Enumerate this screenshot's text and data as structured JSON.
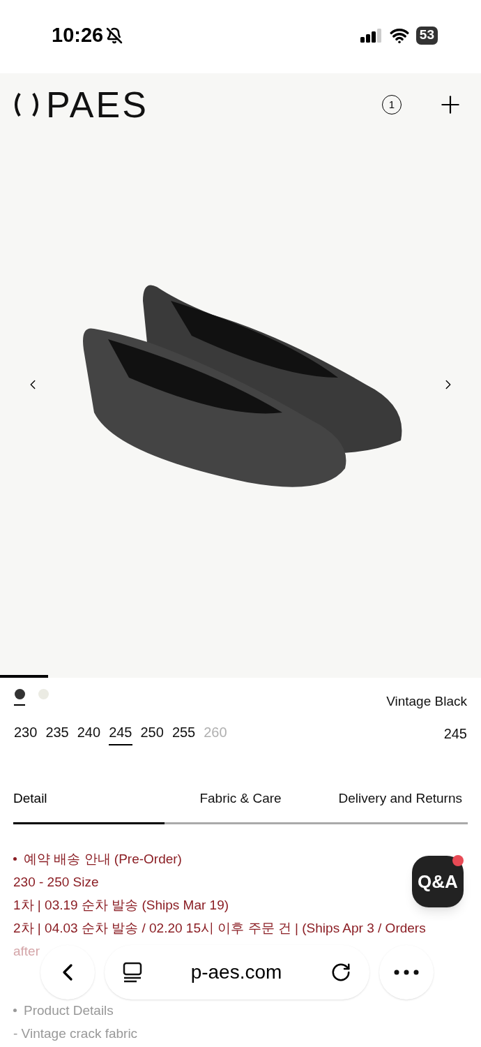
{
  "status_bar": {
    "time": "10:26",
    "battery": "53",
    "muted": true
  },
  "header": {
    "logo": "PAES",
    "cart_count": "1"
  },
  "gallery": {
    "level": 0.1
  },
  "colors": {
    "name": "Vintage Black",
    "swatches": [
      {
        "color": "#333333",
        "selected": true
      },
      {
        "color": "#ebebe3",
        "selected": false
      }
    ]
  },
  "sizes": {
    "selected_label": "245",
    "items": [
      {
        "label": "230",
        "selected": false,
        "disabled": false
      },
      {
        "label": "235",
        "selected": false,
        "disabled": false
      },
      {
        "label": "240",
        "selected": false,
        "disabled": false
      },
      {
        "label": "245",
        "selected": true,
        "disabled": false
      },
      {
        "label": "250",
        "selected": false,
        "disabled": false
      },
      {
        "label": "255",
        "selected": false,
        "disabled": false
      },
      {
        "label": "260",
        "selected": false,
        "disabled": true
      }
    ]
  },
  "tabs": [
    {
      "label": "Detail",
      "selected": true
    },
    {
      "label": "Fabric & Care",
      "selected": false
    },
    {
      "label": "Delivery and Returns",
      "selected": false
    }
  ],
  "detail_lines": [
    {
      "kind": "bullet",
      "text": "예약 배송 안내 (Pre-Order)"
    },
    {
      "kind": "line",
      "text": "230 - 250 Size"
    },
    {
      "kind": "line",
      "text": "1차 | 03.19 순차 발송 (Ships Mar 19)"
    },
    {
      "kind": "line",
      "text": "2차 | 04.03 순차 발송 / 02.20 15시 이후 주문 건 | (Ships Apr 3 / Orders"
    },
    {
      "kind": "faded",
      "text": "after"
    }
  ],
  "faded_lines": [
    {
      "kind": "bullet",
      "text": "Product Details"
    },
    {
      "kind": "line",
      "text": "- Vintage crack fabric"
    }
  ],
  "qa_button": {
    "label": "Q&A",
    "unread": true
  },
  "browser_bar": {
    "url": "p-aes.com"
  }
}
